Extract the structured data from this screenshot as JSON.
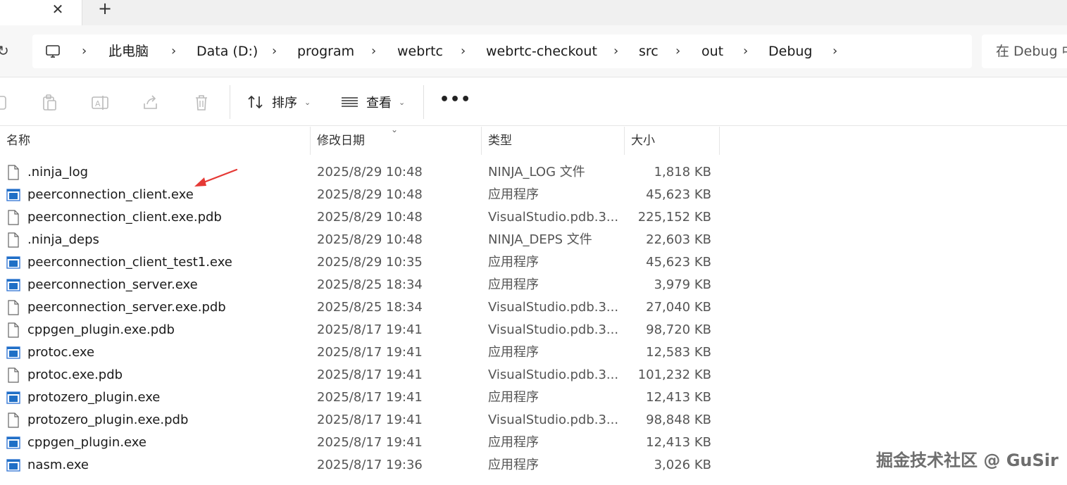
{
  "tabs": {
    "close_glyph": "✕",
    "new_glyph": "+"
  },
  "address": {
    "crumbs": [
      "此电脑",
      "Data (D:)",
      "program",
      "webrtc",
      "webrtc-checkout",
      "src",
      "out",
      "Debug"
    ],
    "separator": "›",
    "search_placeholder": "在 Debug 中"
  },
  "toolbar": {
    "sort_label": "排序",
    "view_label": "查看",
    "more_label": "•••",
    "chevron": "⌄"
  },
  "columns": {
    "name": "名称",
    "date": "修改日期",
    "type": "类型",
    "size": "大小",
    "sort_indicator": "⌄"
  },
  "files": [
    {
      "name": ".ninja_log",
      "date": "2025/8/29 10:48",
      "type": "NINJA_LOG 文件",
      "size": "1,818 KB",
      "icon": "file-icon"
    },
    {
      "name": "peerconnection_client.exe",
      "date": "2025/8/29 10:48",
      "type": "应用程序",
      "size": "45,623 KB",
      "icon": "exe-icon"
    },
    {
      "name": "peerconnection_client.exe.pdb",
      "date": "2025/8/29 10:48",
      "type": "VisualStudio.pdb.3...",
      "size": "225,152 KB",
      "icon": "file-icon"
    },
    {
      "name": ".ninja_deps",
      "date": "2025/8/29 10:48",
      "type": "NINJA_DEPS 文件",
      "size": "22,603 KB",
      "icon": "file-icon"
    },
    {
      "name": "peerconnection_client_test1.exe",
      "date": "2025/8/29 10:35",
      "type": "应用程序",
      "size": "45,623 KB",
      "icon": "exe-icon"
    },
    {
      "name": "peerconnection_server.exe",
      "date": "2025/8/25 18:34",
      "type": "应用程序",
      "size": "3,979 KB",
      "icon": "exe-icon"
    },
    {
      "name": "peerconnection_server.exe.pdb",
      "date": "2025/8/25 18:34",
      "type": "VisualStudio.pdb.3...",
      "size": "27,040 KB",
      "icon": "file-icon"
    },
    {
      "name": "cppgen_plugin.exe.pdb",
      "date": "2025/8/17 19:41",
      "type": "VisualStudio.pdb.3...",
      "size": "98,720 KB",
      "icon": "file-icon"
    },
    {
      "name": "protoc.exe",
      "date": "2025/8/17 19:41",
      "type": "应用程序",
      "size": "12,583 KB",
      "icon": "exe-icon"
    },
    {
      "name": "protoc.exe.pdb",
      "date": "2025/8/17 19:41",
      "type": "VisualStudio.pdb.3...",
      "size": "101,232 KB",
      "icon": "file-icon"
    },
    {
      "name": "protozero_plugin.exe",
      "date": "2025/8/17 19:41",
      "type": "应用程序",
      "size": "12,413 KB",
      "icon": "exe-icon"
    },
    {
      "name": "protozero_plugin.exe.pdb",
      "date": "2025/8/17 19:41",
      "type": "VisualStudio.pdb.3...",
      "size": "98,848 KB",
      "icon": "file-icon"
    },
    {
      "name": "cppgen_plugin.exe",
      "date": "2025/8/17 19:41",
      "type": "应用程序",
      "size": "12,413 KB",
      "icon": "exe-icon"
    },
    {
      "name": "nasm.exe",
      "date": "2025/8/17 19:36",
      "type": "应用程序",
      "size": "3,026 KB",
      "icon": "exe-icon"
    }
  ],
  "watermark": "掘金技术社区 @ GuSir",
  "colors": {
    "exe_blue": "#1f6fc6",
    "annotation_red": "#e53935"
  }
}
